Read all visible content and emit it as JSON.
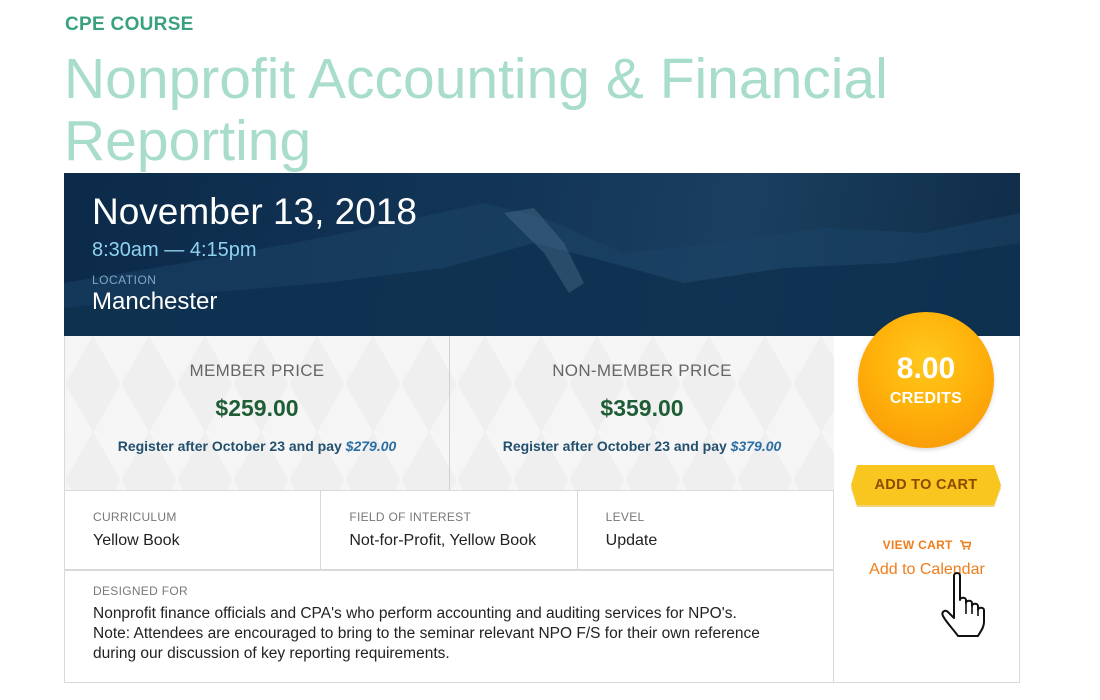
{
  "header": {
    "eyebrow": "CPE COURSE",
    "title": "Nonprofit Accounting & Financial Reporting"
  },
  "event": {
    "date": "November 13, 2018",
    "time": "8:30am — 4:15pm",
    "location_label": "LOCATION",
    "location": "Manchester"
  },
  "pricing": {
    "member": {
      "label": "MEMBER PRICE",
      "price": "$259.00",
      "late_text": "Register after October 23 and pay ",
      "late_price": "$279.00"
    },
    "non_member": {
      "label": "NON-MEMBER PRICE",
      "price": "$359.00",
      "late_text": "Register after October 23 and pay ",
      "late_price": "$379.00"
    }
  },
  "details": {
    "curriculum_label": "CURRICULUM",
    "curriculum": "Yellow Book",
    "field_label": "FIELD OF INTEREST",
    "field": "Not-for-Profit, Yellow Book",
    "level_label": "LEVEL",
    "level": "Update"
  },
  "designed_for": {
    "label": "DESIGNED FOR",
    "line1": "Nonprofit finance officials and CPA's who perform accounting and auditing services for NPO's.",
    "line2": "Note:  Attendees are encouraged to bring to the seminar relevant NPO F/S for their own reference",
    "line3": "during our discussion of key reporting requirements."
  },
  "sidebar": {
    "credits_value": "8.00",
    "credits_label": "CREDITS",
    "add_to_cart": "ADD TO CART",
    "view_cart": "VIEW CART",
    "add_to_calendar": "Add to Calendar"
  },
  "colors": {
    "eyebrow": "#3aa17e",
    "title": "#a8dccb",
    "hero_bg": "#0c2a4a",
    "price_green": "#1f5d36",
    "credits_orange": "#ffb20a",
    "cart_yellow": "#f9c51f",
    "link_orange": "#f07d1b"
  },
  "icons": {
    "cart": "cart-icon",
    "pointer": "hand-pointer-icon"
  }
}
